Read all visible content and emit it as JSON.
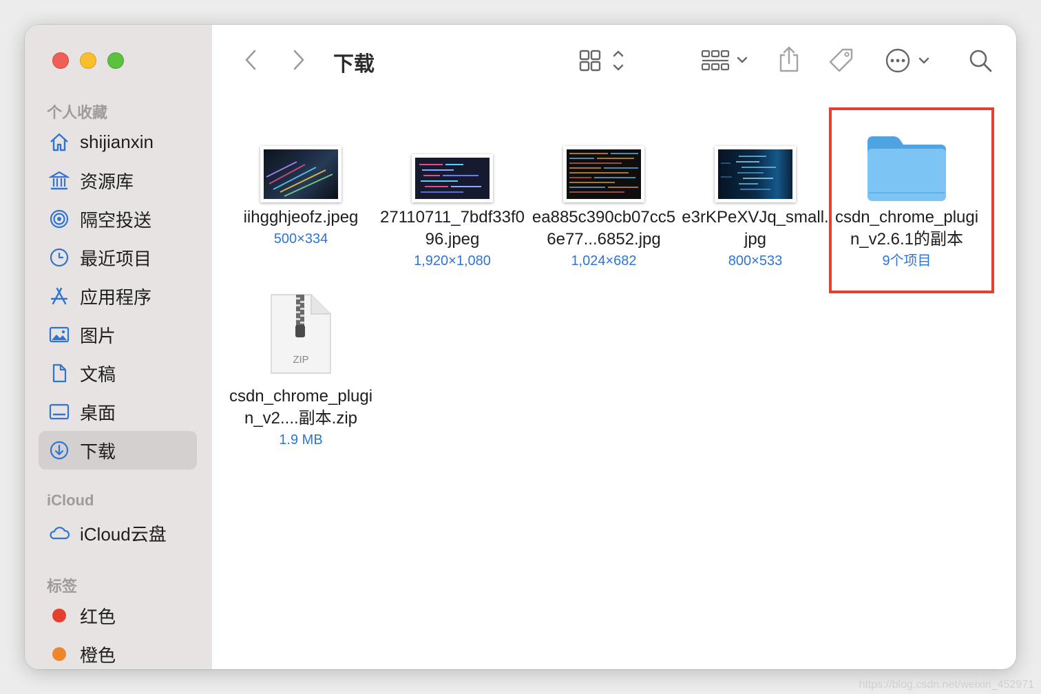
{
  "window": {
    "title": "下载"
  },
  "sidebar": {
    "favorites_header": "个人收藏",
    "favorites": [
      {
        "label": "shijianxin",
        "icon": "home-icon"
      },
      {
        "label": "资源库",
        "icon": "library-icon"
      },
      {
        "label": "隔空投送",
        "icon": "airdrop-icon"
      },
      {
        "label": "最近项目",
        "icon": "clock-icon"
      },
      {
        "label": "应用程序",
        "icon": "applications-icon"
      },
      {
        "label": "图片",
        "icon": "photo-icon"
      },
      {
        "label": "文稿",
        "icon": "document-icon"
      },
      {
        "label": "桌面",
        "icon": "desktop-icon"
      },
      {
        "label": "下载",
        "icon": "download-icon",
        "active": true
      }
    ],
    "icloud_header": "iCloud",
    "icloud": [
      {
        "label": "iCloud云盘",
        "icon": "cloud-icon"
      }
    ],
    "tags_header": "标签",
    "tags": [
      {
        "label": "红色",
        "color": "#e5402f"
      },
      {
        "label": "橙色",
        "color": "#f0862c"
      }
    ]
  },
  "files": [
    {
      "name": "iihgghjeofz.jpeg",
      "meta": "500×334",
      "kind": "image"
    },
    {
      "name": "27110711_7bdf33f096.jpeg",
      "meta": "1,920×1,080",
      "kind": "image"
    },
    {
      "name": "ea885c390cb07cc56e77...6852.jpg",
      "meta": "1,024×682",
      "kind": "image"
    },
    {
      "name": "e3rKPeXVJq_small.jpg",
      "meta": "800×533",
      "kind": "image"
    },
    {
      "name": "csdn_chrome_plugin_v2.6.1的副本",
      "meta": "9个项目",
      "kind": "folder"
    },
    {
      "name": "csdn_chrome_plugin_v2....副本.zip",
      "meta": "1.9 MB",
      "kind": "zip",
      "zip_label": "ZIP"
    }
  ],
  "watermark": "https://blog.csdn.net/weixin_452971",
  "colors": {
    "highlight": "#e5402f",
    "accent": "#2d74d6",
    "folder": "#6fbdf0"
  }
}
